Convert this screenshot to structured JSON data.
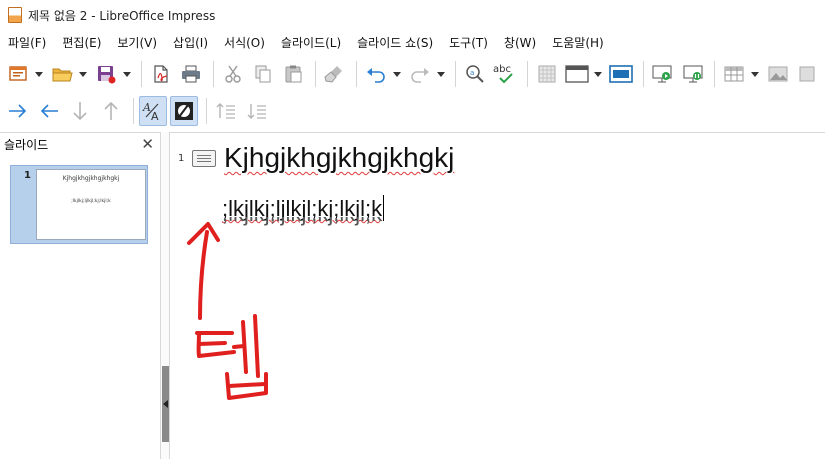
{
  "window": {
    "title": "제목 없음 2 - LibreOffice Impress"
  },
  "menu": [
    "파일(F)",
    "편집(E)",
    "보기(V)",
    "삽입(I)",
    "서식(O)",
    "슬라이드(L)",
    "슬라이드 쇼(S)",
    "도구(T)",
    "창(W)",
    "도움말(H)"
  ],
  "toolbar": {
    "spelling_label": "abc"
  },
  "slides_pane": {
    "title": "슬라이드",
    "close_glyph": "✕",
    "slides": [
      {
        "number": "1",
        "title": "Kjhgjkhgjkhgjkhgkj",
        "body": ";lkjlkj;ljlkjl;kj;lkjl;k"
      }
    ]
  },
  "outline": {
    "slide_number": "1",
    "title": "Kjhgjkhgjkhgjkhgkj",
    "body": ";lkjlkj;ljlkjl;kj;lkjl;k"
  },
  "annotation": {
    "handwritten_text": "탭",
    "color": "#e0201e"
  },
  "colors": {
    "accent_blue": "#2a7fd4",
    "selection_blue": "#cfe0f5",
    "spellcheck_red": "#e03a3a"
  }
}
